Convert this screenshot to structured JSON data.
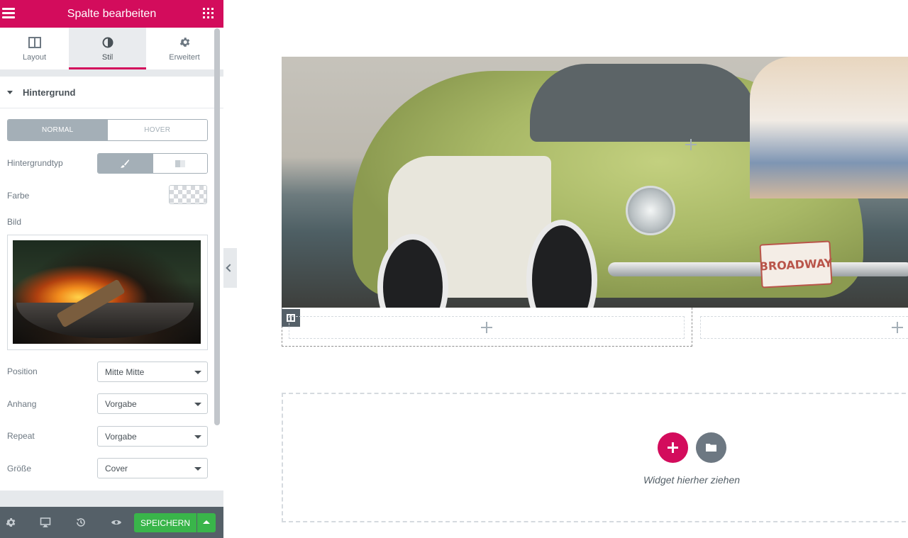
{
  "header": {
    "title": "Spalte bearbeiten"
  },
  "tabs": [
    {
      "label": "Layout",
      "icon": "columns-icon"
    },
    {
      "label": "Stil",
      "icon": "half-circle-icon"
    },
    {
      "label": "Erweitert",
      "icon": "gear-icon"
    }
  ],
  "section": {
    "title": "Hintergrund",
    "state_tabs": [
      "NORMAL",
      "HOVER"
    ],
    "bg_type_label": "Hintergrundtyp",
    "color_label": "Farbe",
    "image_label": "Bild",
    "position": {
      "label": "Position",
      "value": "Mitte Mitte"
    },
    "attachment": {
      "label": "Anhang",
      "value": "Vorgabe"
    },
    "repeat": {
      "label": "Repeat",
      "value": "Vorgabe"
    },
    "size": {
      "label": "Größe",
      "value": "Cover"
    }
  },
  "footer": {
    "save_label": "SPEICHERN"
  },
  "canvas": {
    "plate_text": "BROADWAY",
    "drop_text": "Widget hierher ziehen"
  },
  "colors": {
    "brand": "#d30c5c",
    "save": "#39b54a",
    "footer_bg": "#556068"
  }
}
